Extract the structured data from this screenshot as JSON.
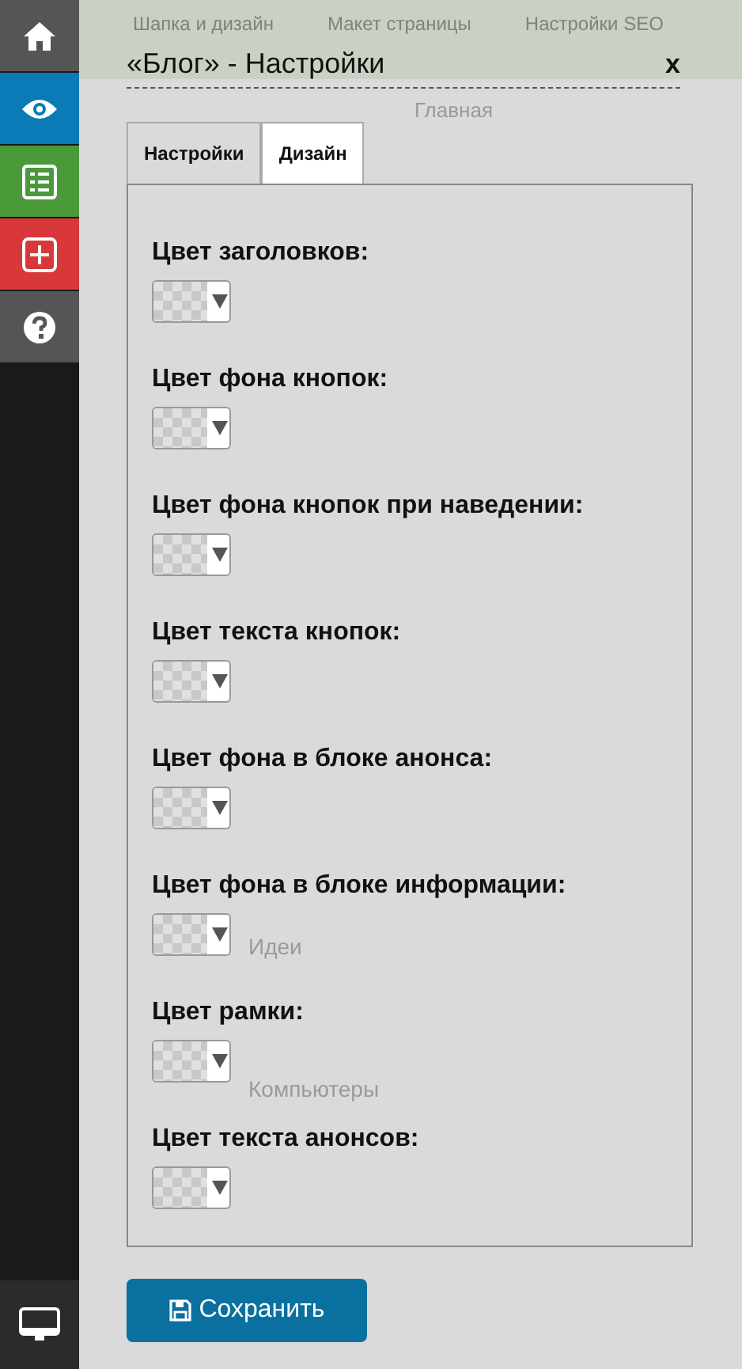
{
  "sidebar": {
    "items": [
      {
        "kind": "home",
        "color": "#555555"
      },
      {
        "kind": "view",
        "color": "#0a7ab8"
      },
      {
        "kind": "list",
        "color": "#4a9a3a"
      },
      {
        "kind": "add",
        "color": "#d9383a"
      },
      {
        "kind": "help",
        "color": "#555555"
      }
    ],
    "bottom_item": {
      "kind": "monitor"
    }
  },
  "background_page": {
    "toolbar": [
      "Шапка и дизайн",
      "Макет страницы",
      "Настройки SEO"
    ],
    "breadcrumb": "Главная",
    "menu_items": [
      "Идеи",
      "Компьютеры"
    ]
  },
  "dialog": {
    "title": "«Блог» - Настройки",
    "close": "x",
    "tabs": [
      {
        "label": "Настройки",
        "selected": false
      },
      {
        "label": "Дизайн",
        "selected": true
      }
    ],
    "fields": [
      {
        "label": "Цвет заголовков:"
      },
      {
        "label": "Цвет фона кнопок:"
      },
      {
        "label": "Цвет фона кнопок при наведении:"
      },
      {
        "label": "Цвет текста кнопок:"
      },
      {
        "label": "Цвет фона в блоке анонса:"
      },
      {
        "label": "Цвет фона в блоке информации:"
      },
      {
        "label": "Цвет рамки:"
      },
      {
        "label": "Цвет текста анонсов:"
      }
    ],
    "save_button": "Сохранить"
  }
}
